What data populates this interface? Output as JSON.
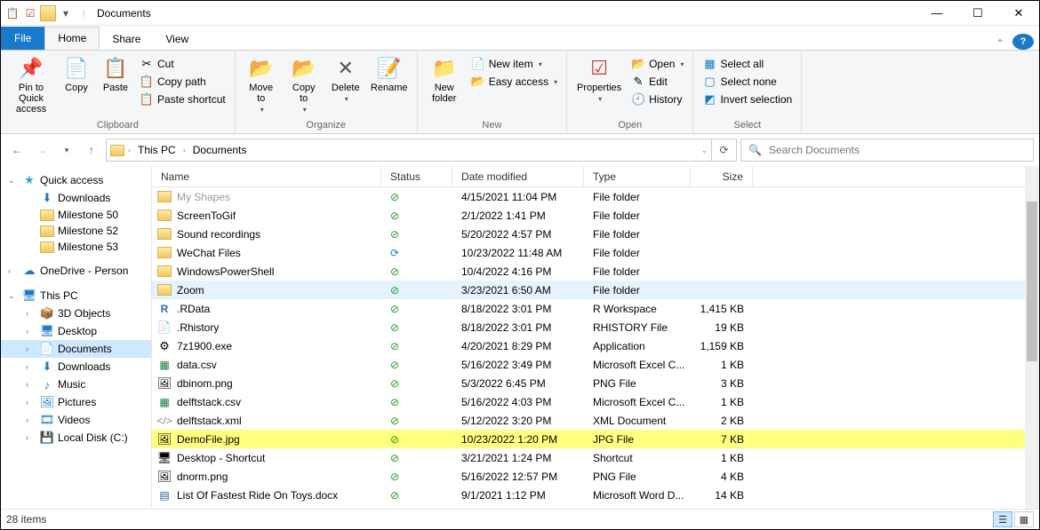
{
  "window": {
    "title": "Documents"
  },
  "tabs": {
    "file": "File",
    "home": "Home",
    "share": "Share",
    "view": "View"
  },
  "ribbon": {
    "clipboard": {
      "label": "Clipboard",
      "pin": "Pin to Quick\naccess",
      "copy": "Copy",
      "paste": "Paste",
      "cut": "Cut",
      "copy_path": "Copy path",
      "paste_shortcut": "Paste shortcut"
    },
    "organize": {
      "label": "Organize",
      "move_to": "Move\nto",
      "copy_to": "Copy\nto",
      "delete": "Delete",
      "rename": "Rename"
    },
    "new": {
      "label": "New",
      "new_folder": "New\nfolder",
      "new_item": "New item",
      "easy_access": "Easy access"
    },
    "open": {
      "label": "Open",
      "properties": "Properties",
      "open": "Open",
      "edit": "Edit",
      "history": "History"
    },
    "select": {
      "label": "Select",
      "select_all": "Select all",
      "select_none": "Select none",
      "invert": "Invert selection"
    }
  },
  "breadcrumb": {
    "root": "This PC",
    "current": "Documents"
  },
  "search": {
    "placeholder": "Search Documents"
  },
  "columns": {
    "name": "Name",
    "status": "Status",
    "date": "Date modified",
    "type": "Type",
    "size": "Size"
  },
  "sidebar": {
    "quick_access": "Quick access",
    "downloads": "Downloads",
    "milestone50": "Milestone 50",
    "milestone52": "Milestone 52",
    "milestone53": "Milestone 53",
    "onedrive": "OneDrive - Person",
    "this_pc": "This PC",
    "objects3d": "3D Objects",
    "desktop": "Desktop",
    "documents": "Documents",
    "downloads2": "Downloads",
    "music": "Music",
    "pictures": "Pictures",
    "videos": "Videos",
    "local_disk": "Local Disk (C:)"
  },
  "files": [
    {
      "name": "My Shapes",
      "icon": "folder",
      "status": "ok",
      "date": "4/15/2021 11:04 PM",
      "type": "File folder",
      "size": "",
      "cut": true
    },
    {
      "name": "ScreenToGif",
      "icon": "folder",
      "status": "ok",
      "date": "2/1/2022 1:41 PM",
      "type": "File folder",
      "size": ""
    },
    {
      "name": "Sound recordings",
      "icon": "folder",
      "status": "ok",
      "date": "5/20/2022 4:57 PM",
      "type": "File folder",
      "size": ""
    },
    {
      "name": "WeChat Files",
      "icon": "folder",
      "status": "sync",
      "date": "10/23/2022 11:48 AM",
      "type": "File folder",
      "size": ""
    },
    {
      "name": "WindowsPowerShell",
      "icon": "folder",
      "status": "ok",
      "date": "10/4/2022 4:16 PM",
      "type": "File folder",
      "size": ""
    },
    {
      "name": "Zoom",
      "icon": "folder",
      "status": "ok",
      "date": "3/23/2021 6:50 AM",
      "type": "File folder",
      "size": "",
      "hover": true
    },
    {
      "name": ".RData",
      "icon": "r",
      "status": "ok",
      "date": "8/18/2022 3:01 PM",
      "type": "R Workspace",
      "size": "1,415 KB"
    },
    {
      "name": ".Rhistory",
      "icon": "blank",
      "status": "ok",
      "date": "8/18/2022 3:01 PM",
      "type": "RHISTORY File",
      "size": "19 KB"
    },
    {
      "name": "7z1900.exe",
      "icon": "exe",
      "status": "ok",
      "date": "4/20/2021 8:29 PM",
      "type": "Application",
      "size": "1,159 KB"
    },
    {
      "name": "data.csv",
      "icon": "xls",
      "status": "ok",
      "date": "5/16/2022 3:49 PM",
      "type": "Microsoft Excel C...",
      "size": "1 KB"
    },
    {
      "name": "dbinom.png",
      "icon": "png",
      "status": "ok",
      "date": "5/3/2022 6:45 PM",
      "type": "PNG File",
      "size": "3 KB"
    },
    {
      "name": "delftstack.csv",
      "icon": "xls",
      "status": "ok",
      "date": "5/16/2022 4:03 PM",
      "type": "Microsoft Excel C...",
      "size": "1 KB"
    },
    {
      "name": "delftstack.xml",
      "icon": "xml",
      "status": "ok",
      "date": "5/12/2022 3:20 PM",
      "type": "XML Document",
      "size": "2 KB"
    },
    {
      "name": "DemoFile.jpg",
      "icon": "jpg",
      "status": "ok",
      "date": "10/23/2022 1:20 PM",
      "type": "JPG File",
      "size": "7 KB",
      "highlight": true
    },
    {
      "name": "Desktop - Shortcut",
      "icon": "shortcut",
      "status": "ok",
      "date": "3/21/2021 1:24 PM",
      "type": "Shortcut",
      "size": "1 KB"
    },
    {
      "name": "dnorm.png",
      "icon": "png",
      "status": "ok",
      "date": "5/16/2022 12:57 PM",
      "type": "PNG File",
      "size": "4 KB"
    },
    {
      "name": "List Of Fastest Ride On Toys.docx",
      "icon": "doc",
      "status": "ok",
      "date": "9/1/2021 1:12 PM",
      "type": "Microsoft Word D...",
      "size": "14 KB"
    }
  ],
  "statusbar": {
    "count": "28 items"
  }
}
